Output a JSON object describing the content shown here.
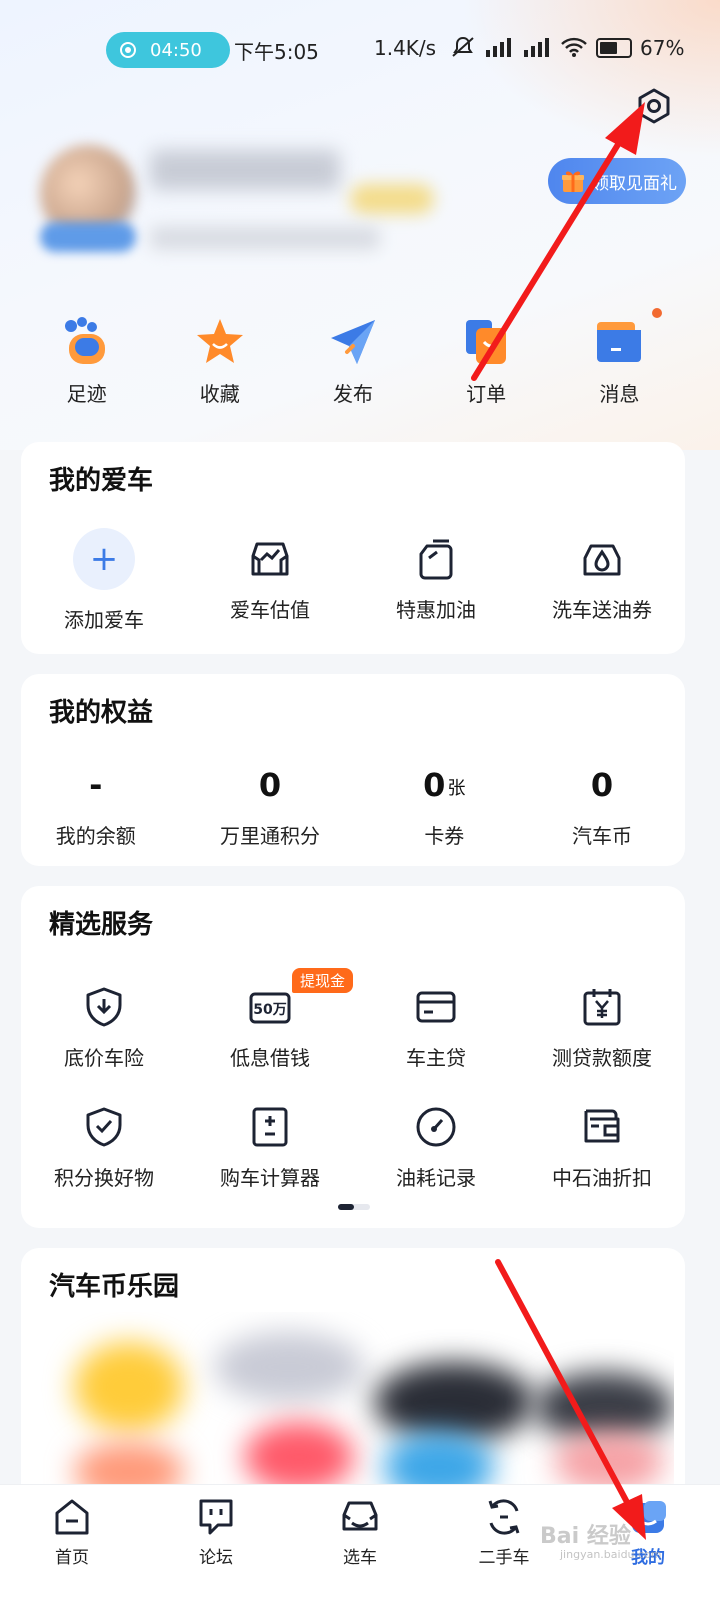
{
  "status_bar": {
    "recording_time": "04:50",
    "time": "下午5:05",
    "net_speed": "1.4K/s",
    "battery": "67%"
  },
  "profile": {
    "gift_label": "领取见面礼"
  },
  "quick_actions": [
    {
      "label": "足迹",
      "icon": "footprint-icon"
    },
    {
      "label": "收藏",
      "icon": "star-icon"
    },
    {
      "label": "发布",
      "icon": "send-icon"
    },
    {
      "label": "订单",
      "icon": "order-icon"
    },
    {
      "label": "消息",
      "icon": "message-icon"
    }
  ],
  "my_car": {
    "title": "我的爱车",
    "items": [
      {
        "label": "添加爱车",
        "icon": "plus-icon"
      },
      {
        "label": "爱车估值",
        "icon": "car-value-icon"
      },
      {
        "label": "特惠加油",
        "icon": "fuel-can-icon"
      },
      {
        "label": "洗车送油券",
        "icon": "car-wash-icon"
      }
    ]
  },
  "rights": {
    "title": "我的权益",
    "items": [
      {
        "value": "-",
        "unit": "",
        "label": "我的余额"
      },
      {
        "value": "0",
        "unit": "",
        "label": "万里通积分"
      },
      {
        "value": "0",
        "unit": "张",
        "label": "卡券"
      },
      {
        "value": "0",
        "unit": "",
        "label": "汽车币"
      }
    ]
  },
  "services": {
    "title": "精选服务",
    "badge": "提现金",
    "loan_icon_text": "50万",
    "row1": [
      {
        "label": "底价车险",
        "icon": "insurance-shield-icon"
      },
      {
        "label": "低息借钱",
        "icon": "loan-50w-icon"
      },
      {
        "label": "车主贷",
        "icon": "card-icon"
      },
      {
        "label": "测贷款额度",
        "icon": "calendar-yen-icon"
      }
    ],
    "row2": [
      {
        "label": "积分换好物",
        "icon": "shield-check-icon"
      },
      {
        "label": "购车计算器",
        "icon": "calculator-icon"
      },
      {
        "label": "油耗记录",
        "icon": "gauge-icon"
      },
      {
        "label": "中石油折扣",
        "icon": "wallet-icon"
      }
    ]
  },
  "park": {
    "title": "汽车币乐园"
  },
  "tabbar": [
    {
      "label": "首页",
      "icon": "home-icon",
      "active": false
    },
    {
      "label": "论坛",
      "icon": "forum-icon",
      "active": false
    },
    {
      "label": "选车",
      "icon": "car-select-icon",
      "active": false
    },
    {
      "label": "二手车",
      "icon": "used-car-icon",
      "active": false
    },
    {
      "label": "我的",
      "icon": "profile-tab-icon",
      "active": true
    }
  ],
  "watermark": {
    "text": "Bai 经验",
    "sub": "jingyan.baidu.com"
  },
  "colors": {
    "accent": "#2f6de1",
    "badge": "#ff6a1a",
    "annotation_arrow": "#f21b1b"
  }
}
